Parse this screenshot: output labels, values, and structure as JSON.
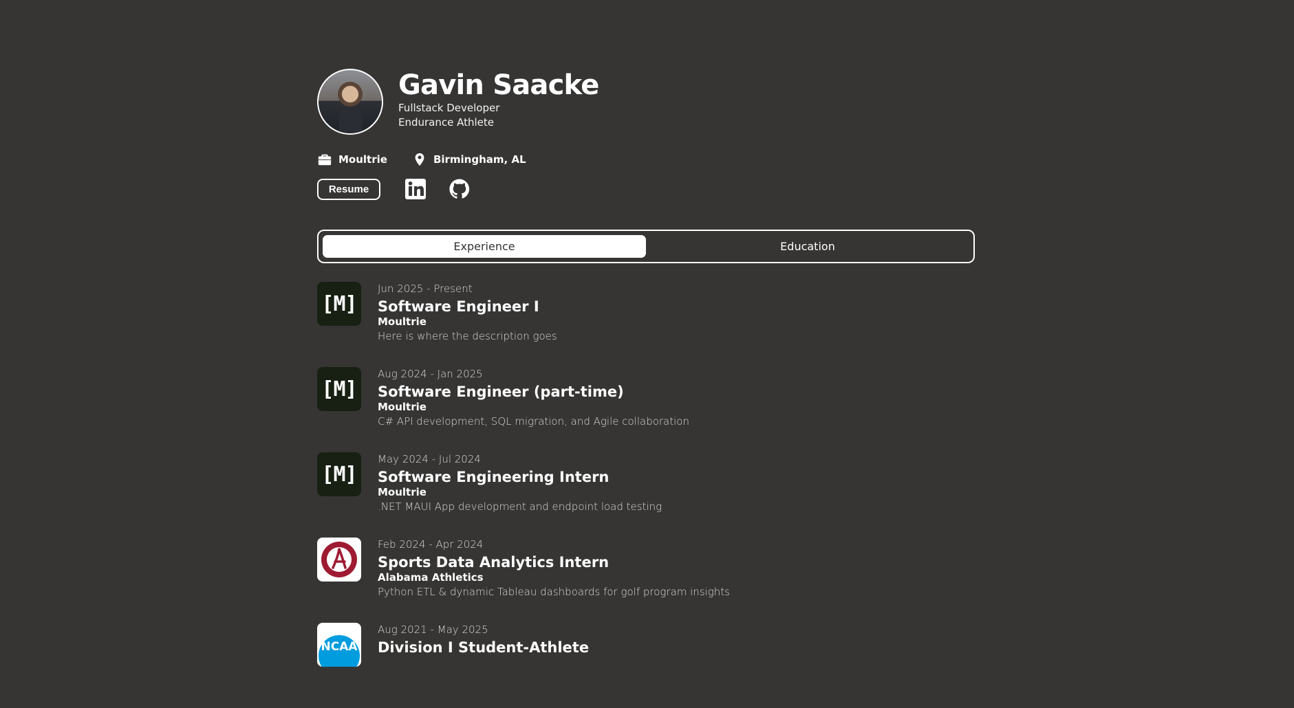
{
  "profile": {
    "name": "Gavin Saacke",
    "subtitle_1": "Fullstack Developer",
    "subtitle_2": "Endurance Athlete",
    "company": "Moultrie",
    "location": "Birmingham, AL",
    "resume_label": "Resume",
    "avatar_icon": "profile-photo",
    "briefcase_icon": "briefcase-icon",
    "location_icon": "map-pin-icon",
    "linkedin_icon": "linkedin-icon",
    "github_icon": "github-icon"
  },
  "tabs": [
    {
      "label": "Experience",
      "active": true
    },
    {
      "label": "Education",
      "active": false
    }
  ],
  "experience": [
    {
      "dates": "Jun 2025 - Present",
      "title": "Software Engineer I",
      "company": "Moultrie",
      "description": "Here is where the description goes",
      "logo": "M"
    },
    {
      "dates": "Aug 2024 - Jan 2025",
      "title": "Software Engineer (part-time)",
      "company": "Moultrie",
      "description": "C# API development, SQL migration, and Agile collaboration",
      "logo": "M"
    },
    {
      "dates": "May 2024 - Jul 2024",
      "title": "Software Engineering Intern",
      "company": "Moultrie",
      "description": ".NET MAUI App development and endpoint load testing",
      "logo": "M"
    },
    {
      "dates": "Feb 2024 - Apr 2024",
      "title": "Sports Data Analytics Intern",
      "company": "Alabama Athletics",
      "description": "Python ETL & dynamic Tableau dashboards for golf program insights",
      "logo": "A"
    },
    {
      "dates": "Aug 2021 - May 2025",
      "title": "Division I Student-Athlete",
      "company": "",
      "description": "",
      "logo": "NCAA"
    }
  ],
  "colors": {
    "background": "#363534",
    "text": "#ffffff",
    "muted": "#d7d7d7",
    "moultrie_logo": "#172013",
    "alabama_red": "#9e1b32",
    "ncaa_blue": "#009cde"
  }
}
